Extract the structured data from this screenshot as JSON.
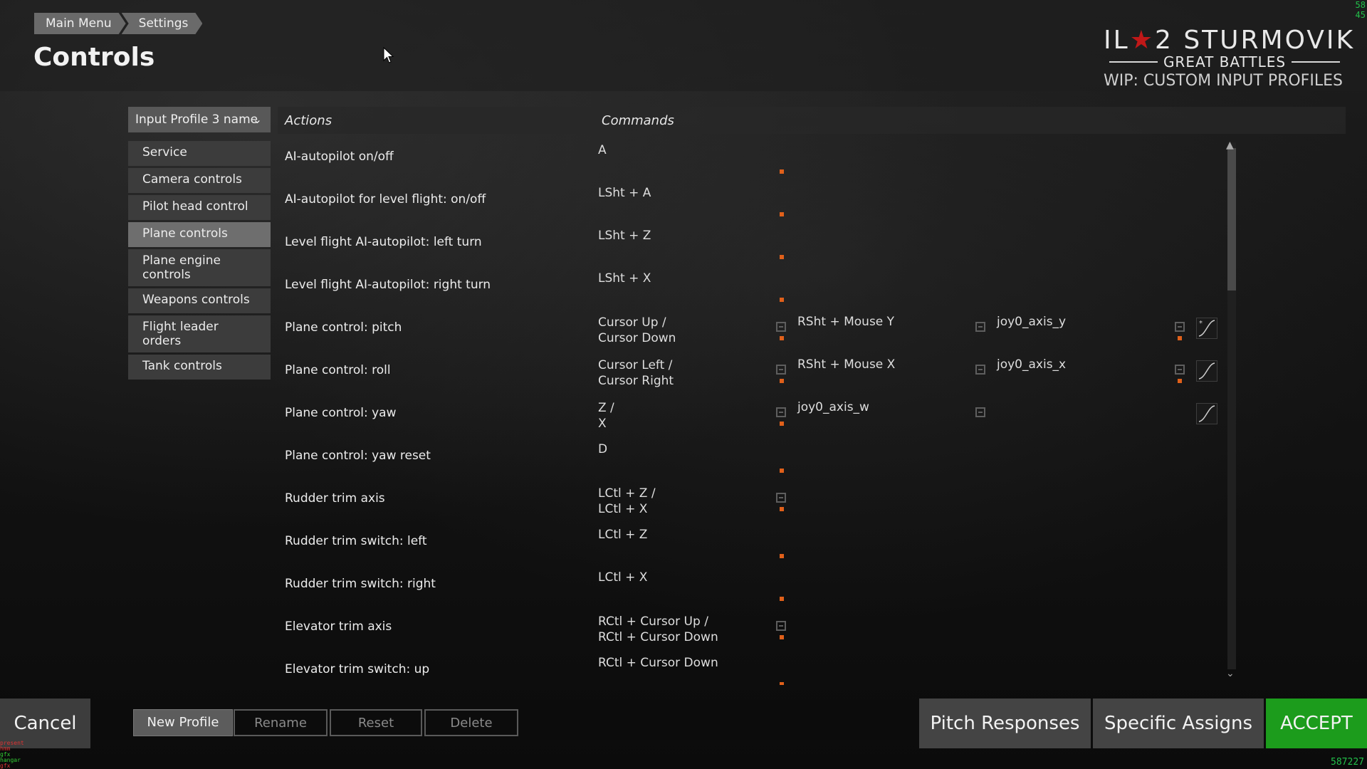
{
  "breadcrumb": [
    "Main Menu",
    "Settings"
  ],
  "page_title": "Controls",
  "logo": {
    "main_left": "IL",
    "star": "★",
    "main_right": "2 STURMOVIK",
    "subtitle": "GREAT BATTLES",
    "wip": "WIP: CUSTOM INPUT PROFILES"
  },
  "fps": [
    "58",
    "45"
  ],
  "profile": {
    "selected": "Input Profile 3 name"
  },
  "categories": [
    {
      "label": "Service"
    },
    {
      "label": "Camera controls"
    },
    {
      "label": "Pilot head control"
    },
    {
      "label": "Plane controls"
    },
    {
      "label": "Plane engine controls"
    },
    {
      "label": "Weapons controls"
    },
    {
      "label": "Flight leader orders"
    },
    {
      "label": "Tank controls"
    }
  ],
  "active_category": "Plane controls",
  "table": {
    "actions_header": "Actions",
    "commands_header": "Commands",
    "rows": [
      {
        "action": "AI-autopilot on/off",
        "cmd": [
          "A"
        ],
        "slot2": "",
        "slot3": "",
        "axis": false,
        "curve": false,
        "dot2": false,
        "star": false
      },
      {
        "action": "AI-autopilot for level flight: on/off",
        "cmd": [
          "LSht + A"
        ],
        "slot2": "",
        "slot3": "",
        "axis": false,
        "curve": false,
        "dot2": false,
        "star": false
      },
      {
        "action": "Level flight AI-autopilot: left turn",
        "cmd": [
          "LSht + Z"
        ],
        "slot2": "",
        "slot3": "",
        "axis": false,
        "curve": false,
        "dot2": false,
        "star": false
      },
      {
        "action": "Level flight AI-autopilot: right turn",
        "cmd": [
          "LSht + X"
        ],
        "slot2": "",
        "slot3": "",
        "axis": false,
        "curve": false,
        "dot2": false,
        "star": false
      },
      {
        "action": "Plane control: pitch",
        "cmd": [
          "Cursor Up /",
          "Cursor Down"
        ],
        "slot2": "RSht + Mouse Y",
        "slot3": "joy0_axis_y",
        "axis": true,
        "curve": true,
        "dot2": true,
        "star": true
      },
      {
        "action": "Plane control: roll",
        "cmd": [
          "Cursor Left /",
          "Cursor Right"
        ],
        "slot2": "RSht + Mouse X",
        "slot3": "joy0_axis_x",
        "axis": true,
        "curve": true,
        "dot2": true,
        "star": false
      },
      {
        "action": "Plane control: yaw",
        "cmd": [
          "Z /",
          "X"
        ],
        "slot2": "joy0_axis_w",
        "slot3": "",
        "axis": true,
        "curve": true,
        "dot2": false,
        "star": false
      },
      {
        "action": "Plane control: yaw reset",
        "cmd": [
          "D"
        ],
        "slot2": "",
        "slot3": "",
        "axis": false,
        "curve": false,
        "dot2": false,
        "star": false
      },
      {
        "action": "Rudder trim axis",
        "cmd": [
          "LCtl + Z /",
          "LCtl + X"
        ],
        "slot2": "",
        "slot3": "",
        "axis": true,
        "curve": false,
        "dot2": false,
        "star": false
      },
      {
        "action": "Rudder trim switch: left",
        "cmd": [
          "LCtl + Z"
        ],
        "slot2": "",
        "slot3": "",
        "axis": false,
        "curve": false,
        "dot2": false,
        "star": false
      },
      {
        "action": "Rudder trim switch: right",
        "cmd": [
          "LCtl + X"
        ],
        "slot2": "",
        "slot3": "",
        "axis": false,
        "curve": false,
        "dot2": false,
        "star": false
      },
      {
        "action": "Elevator trim axis",
        "cmd": [
          "RCtl + Cursor Up /",
          "RCtl + Cursor Down"
        ],
        "slot2": "",
        "slot3": "",
        "axis": true,
        "curve": false,
        "dot2": false,
        "star": false
      },
      {
        "action": "Elevator trim switch: up",
        "cmd": [
          "RCtl + Cursor Down"
        ],
        "slot2": "",
        "slot3": "",
        "axis": false,
        "curve": false,
        "dot2": false,
        "star": false
      }
    ]
  },
  "buttons": {
    "cancel": "Cancel",
    "new_profile": "New Profile",
    "rename": "Rename",
    "reset": "Reset",
    "delete": "Delete",
    "pitch_responses": "Pitch Responses",
    "specific_assigns": "Specific Assigns",
    "accept": "ACCEPT"
  },
  "debug_lines": [
    "present",
    "hmm",
    "gfx",
    "hangar",
    "gfx"
  ],
  "serial": "587227",
  "colors": {
    "accept": "#1c9c1c",
    "assign_dot": "#e0601a",
    "fps": "#22c04a",
    "logo_star": "#c01818"
  }
}
